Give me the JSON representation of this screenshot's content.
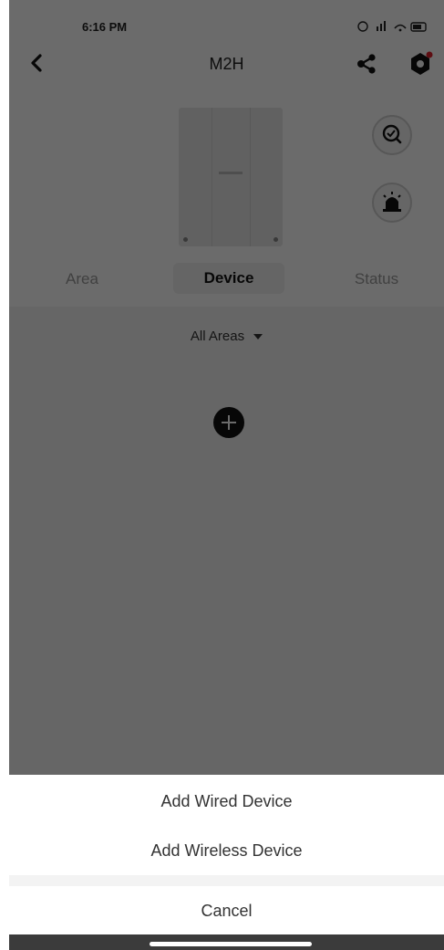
{
  "status_bar": {
    "time": "6:16 PM"
  },
  "header": {
    "title": "M2H"
  },
  "tabs": [
    {
      "label": "Area"
    },
    {
      "label": "Device"
    },
    {
      "label": "Status"
    }
  ],
  "filter": {
    "label": "All Areas"
  },
  "sheet": {
    "options": [
      {
        "label": "Add Wired Device"
      },
      {
        "label": "Add Wireless Device"
      }
    ],
    "cancel": "Cancel"
  },
  "icons": {
    "back": "chevron-left-icon",
    "share": "share-icon",
    "settings": "gear-icon",
    "detect": "search-check-icon",
    "alarm": "siren-icon",
    "add": "plus-icon"
  },
  "colors": {
    "overlay": "#000000",
    "accent_dot": "#e0202b"
  }
}
